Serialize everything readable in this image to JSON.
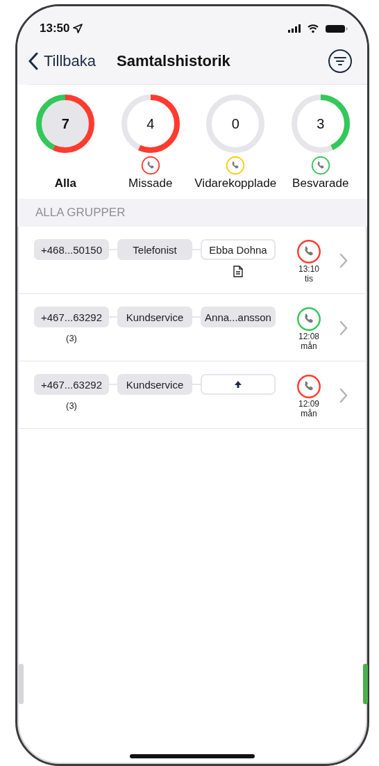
{
  "status_bar": {
    "time": "13:50"
  },
  "nav": {
    "back": "Tillbaka",
    "title": "Samtalshistorik"
  },
  "stats": [
    {
      "count": "7",
      "label": "Alla",
      "selected": true,
      "segments": [
        {
          "color": "#ff3b30",
          "level": 0.57
        },
        {
          "color": "#34c759",
          "level": 0.43
        }
      ]
    },
    {
      "count": "4",
      "label": "Missade",
      "selected": false,
      "color": "#ff3b30",
      "segments": [
        {
          "color": "#ff3b30",
          "level": 0.57
        }
      ]
    },
    {
      "count": "0",
      "label": "Vidarekopplade",
      "selected": false,
      "color": "#ffcc00"
    },
    {
      "count": "3",
      "label": "Besvarade",
      "selected": false,
      "color": "#34c759",
      "segments": [
        {
          "color": "#34c759",
          "level": 0.43
        }
      ]
    }
  ],
  "section": "ALLA GRUPPER",
  "calls": [
    {
      "number": "+468...50150",
      "group": "Telefonist",
      "agent": {
        "kind": "outlined",
        "text": "Ebba Dohna"
      },
      "note": true,
      "color": "#ff3b30",
      "time": "13:10",
      "day": "tis"
    },
    {
      "number": "+467...63292",
      "count": "(3)",
      "group": "Kundservice",
      "agent": {
        "kind": "filled",
        "text": "Anna...ansson"
      },
      "note": false,
      "color": "#34c759",
      "time": "12:08",
      "day": "mån"
    },
    {
      "number": "+467...63292",
      "count": "(3)",
      "group": "Kundservice",
      "agent": {
        "kind": "upload"
      },
      "note": false,
      "color": "#ff3b30",
      "time": "12:09",
      "day": "mån"
    }
  ]
}
